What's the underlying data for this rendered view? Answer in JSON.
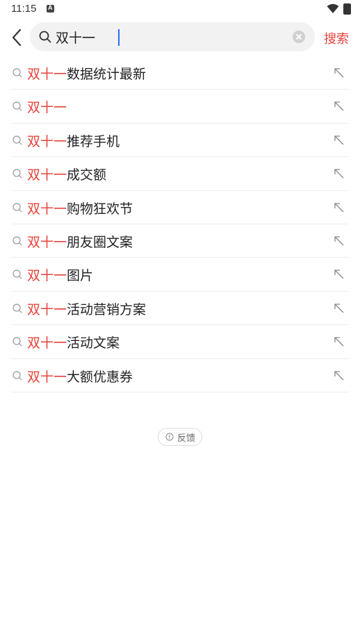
{
  "status_bar": {
    "time": "11:15",
    "icons": [
      "notification-a-icon",
      "wifi-icon",
      "battery-icon"
    ]
  },
  "search": {
    "query": "双十一",
    "submit_label": "搜索",
    "highlight_color": "#e8423a"
  },
  "suggestions": [
    {
      "highlight": "双十一",
      "rest": "数据统计最新"
    },
    {
      "highlight": "双十一",
      "rest": ""
    },
    {
      "highlight": "双十一",
      "rest": "推荐手机"
    },
    {
      "highlight": "双十一",
      "rest": "成交额"
    },
    {
      "highlight": "双十一",
      "rest": "购物狂欢节"
    },
    {
      "highlight": "双十一",
      "rest": "朋友圈文案"
    },
    {
      "highlight": "双十一",
      "rest": "图片"
    },
    {
      "highlight": "双十一",
      "rest": "活动营销方案"
    },
    {
      "highlight": "双十一",
      "rest": "活动文案"
    },
    {
      "highlight": "双十一",
      "rest": "大额优惠券"
    }
  ],
  "feedback": {
    "label": "反馈"
  }
}
